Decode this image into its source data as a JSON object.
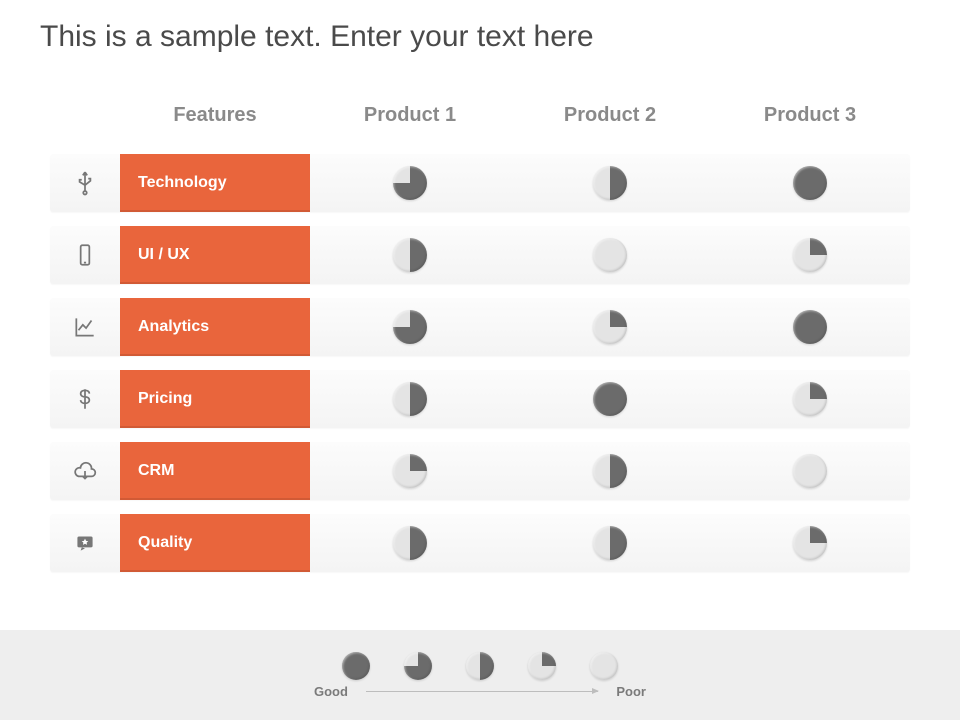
{
  "title": "This is a sample text. Enter your text here",
  "colors": {
    "accent": "#e9653c",
    "dark": "#6b6b6b",
    "light": "#e4e4e4"
  },
  "headers": {
    "features": "Features",
    "products": [
      "Product 1",
      "Product 2",
      "Product 3"
    ]
  },
  "rows": [
    {
      "icon": "usb-icon",
      "label": "Technology",
      "values": [
        75,
        50,
        100
      ]
    },
    {
      "icon": "phone-icon",
      "label": "UI / UX",
      "values": [
        50,
        0,
        25
      ]
    },
    {
      "icon": "chart-icon",
      "label": "Analytics",
      "values": [
        75,
        25,
        100
      ]
    },
    {
      "icon": "dollar-icon",
      "label": "Pricing",
      "values": [
        50,
        100,
        25
      ]
    },
    {
      "icon": "cloud-icon",
      "label": "CRM",
      "values": [
        25,
        50,
        0
      ]
    },
    {
      "icon": "star-icon",
      "label": "Quality",
      "values": [
        50,
        50,
        25
      ]
    }
  ],
  "legend": {
    "good": "Good",
    "poor": "Poor",
    "scale": [
      100,
      75,
      50,
      25,
      0
    ]
  },
  "chart_data": {
    "type": "table",
    "title": "Product feature comparison (Harvey-ball fill percentage)",
    "note": "100 = Good, 0 = Poor",
    "columns": [
      "Product 1",
      "Product 2",
      "Product 3"
    ],
    "rows": [
      "Technology",
      "UI / UX",
      "Analytics",
      "Pricing",
      "CRM",
      "Quality"
    ],
    "values": [
      [
        75,
        50,
        100
      ],
      [
        50,
        0,
        25
      ],
      [
        75,
        25,
        100
      ],
      [
        50,
        100,
        25
      ],
      [
        25,
        50,
        0
      ],
      [
        50,
        50,
        25
      ]
    ],
    "legend_scale": {
      "100": "Good",
      "0": "Poor"
    }
  }
}
